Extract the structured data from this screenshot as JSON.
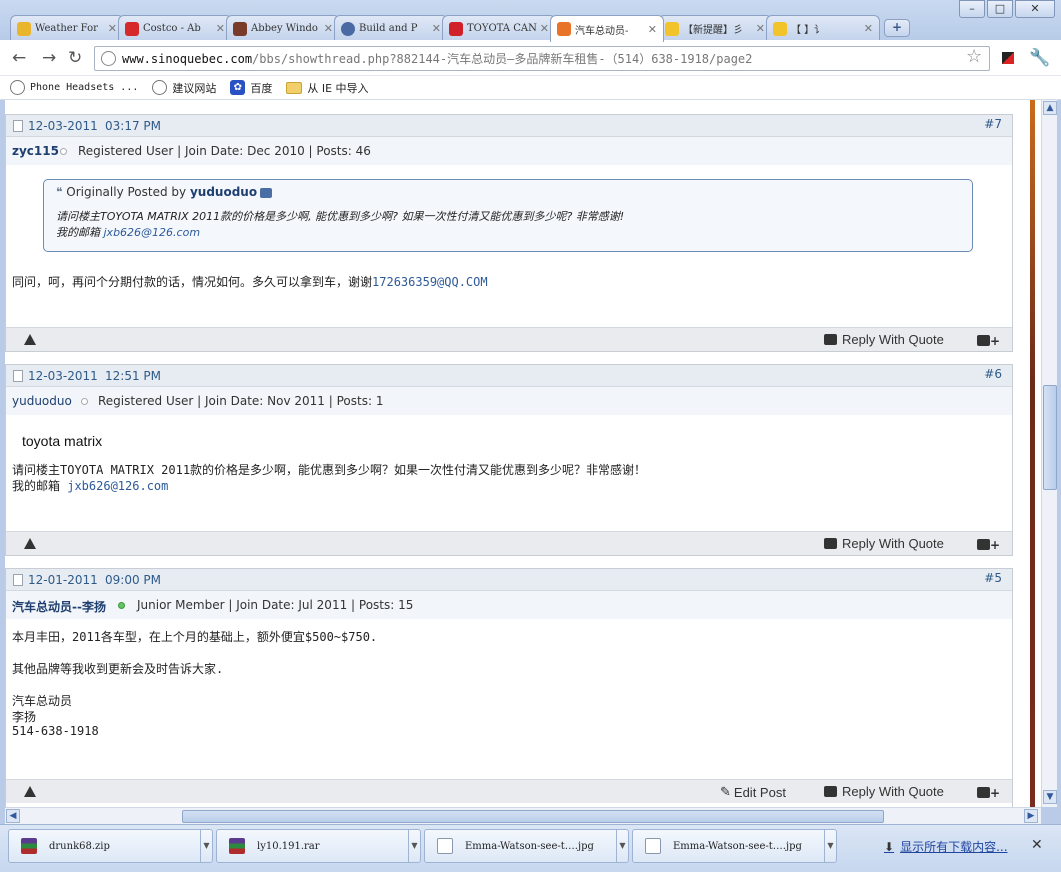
{
  "window": {
    "minimize": "–",
    "maximize": "□",
    "close": "✕"
  },
  "tabs": [
    {
      "label": "Weather For",
      "color": "#e8b52d"
    },
    {
      "label": "Costco - Ab",
      "color": "#d62a2a"
    },
    {
      "label": "Abbey Windo",
      "color": "#7a3a2a"
    },
    {
      "label": "Build and P",
      "color": "#4a6aa4"
    },
    {
      "label": "TOYOTA CANA",
      "color": "#d0202a"
    },
    {
      "label": "汽车总动员-",
      "color": "#e8742a",
      "active": true
    },
    {
      "label": "【新提醒】彡",
      "color": "#f2c32b"
    },
    {
      "label": "【       】讠",
      "color": "#f2c32b"
    }
  ],
  "toolbar": {
    "back": "←",
    "forward": "→",
    "reload": "↻",
    "url_host": "www.sinoquebec.com",
    "url_path": "/bbs/showthread.php?882144-汽车总动员—多品牌新车租售-（514）638-1918/page2",
    "star": "☆",
    "wrench": "🔧"
  },
  "bookmarks": [
    {
      "label": "Phone Headsets  ...",
      "type": "globe"
    },
    {
      "label": "建议网站",
      "type": "globe"
    },
    {
      "label": "百度",
      "type": "paw"
    },
    {
      "label": "从 IE 中导入",
      "type": "folder"
    }
  ],
  "posts": [
    {
      "date": "12-03-2011",
      "time": "03:17 PM",
      "number": "#7",
      "username": "zyc115",
      "online": false,
      "user_info": "Registered User | Join Date: Dec 2010 | Posts: 46",
      "quote": {
        "prefix": "Originally Posted by ",
        "author": "yuduoduo",
        "line1": "请问楼主TOYOTA MATRIX 2011款的价格是多少啊, 能优惠到多少啊? 如果一次性付清又能优惠到多少呢? 非常感谢!",
        "line2_prefix": "我的邮箱 ",
        "line2_email": "jxb626@126.com"
      },
      "message_text": "同问，呵，再问个分期付款的话，情况如何。多久可以拿到车，谢谢",
      "message_email": "172636359@QQ.COM",
      "reply_label": "Reply With Quote",
      "multiquote_label": "+"
    },
    {
      "date": "12-03-2011",
      "time": "12:51 PM",
      "number": "#6",
      "username": "yuduoduo",
      "online": false,
      "user_info": "Registered User | Join Date: Nov 2011 | Posts: 1",
      "title": "toyota matrix",
      "message_line1": "请问楼主TOYOTA MATRIX 2011款的价格是多少啊，能优惠到多少啊？如果一次性付清又能优惠到多少呢？非常感谢！",
      "message_line2_prefix": "我的邮箱 ",
      "message_email": "jxb626@126.com",
      "reply_label": "Reply With Quote",
      "multiquote_label": "+"
    },
    {
      "date": "12-01-2011",
      "time": "09:00 PM",
      "number": "#5",
      "username": "汽车总动员--李扬",
      "online": true,
      "user_info": "Junior Member | Join Date: Jul 2011 | Posts: 15",
      "lines": [
        "本月丰田，2011各车型，在上个月的基础上，额外便宜$500~$750.",
        "",
        "其他品牌等我收到更新会及时告诉大家.",
        "",
        "汽车总动员",
        "李扬",
        "514-638-1918"
      ],
      "edit_label": "Edit Post",
      "reply_label": "Reply With Quote",
      "multiquote_label": "+"
    }
  ],
  "downloads": [
    {
      "name": "drunk68.zip",
      "kind": "zip"
    },
    {
      "name": "ly10.191.rar",
      "kind": "zip"
    },
    {
      "name": "Emma-Watson-see-t….jpg",
      "kind": "jpg"
    },
    {
      "name": "Emma-Watson-see-t….jpg",
      "kind": "jpg"
    }
  ],
  "download_bar": {
    "show_all": "显示所有下载内容...",
    "close": "✕"
  }
}
